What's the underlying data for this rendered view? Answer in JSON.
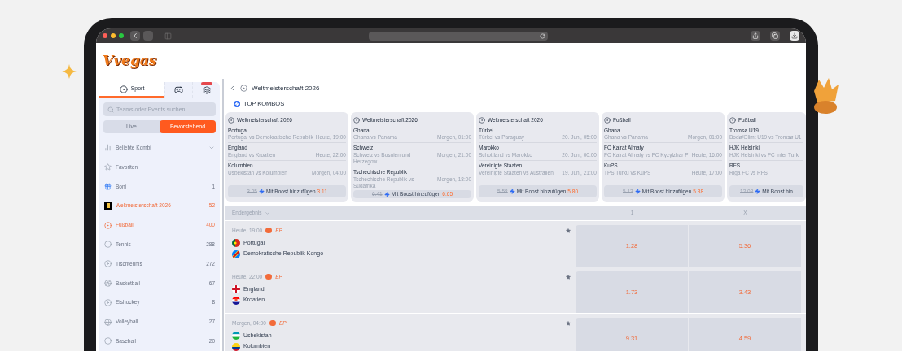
{
  "logo": {
    "text": "Vvegas"
  },
  "sidebar": {
    "tabs": [
      {
        "kind": "sport",
        "label": "Sport",
        "selected": true
      },
      {
        "kind": "games",
        "selected": false
      },
      {
        "kind": "casino",
        "selected": false
      }
    ],
    "search": {
      "placeholder": "Teams oder Events suchen"
    },
    "modes": [
      {
        "label": "Live",
        "selected": false
      },
      {
        "label": "Bevorstehend",
        "selected": true
      }
    ],
    "items": [
      {
        "kind": "combo",
        "label": "Beliebte Kombi",
        "expandable": true,
        "selected": false
      },
      {
        "kind": "favorites",
        "label": "Favoriten",
        "selected": false
      },
      {
        "kind": "bonus",
        "label": "Boni",
        "count": "1",
        "selected": false
      },
      {
        "kind": "worldcup",
        "label": "Weltmeisterschaft 2026",
        "count": "52",
        "selected": true
      },
      {
        "kind": "football",
        "label": "Fußball",
        "count": "400",
        "selected": true
      },
      {
        "kind": "tennis",
        "label": "Tennis",
        "count": "288",
        "selected": false
      },
      {
        "kind": "table_tennis",
        "label": "Tischtennis",
        "count": "272",
        "selected": false
      },
      {
        "kind": "basketball",
        "label": "Basketball",
        "count": "67",
        "selected": false
      },
      {
        "kind": "hockey",
        "label": "Eishockey",
        "count": "8",
        "selected": false
      },
      {
        "kind": "volleyball",
        "label": "Volleyball",
        "count": "27",
        "selected": false
      },
      {
        "kind": "baseball",
        "label": "Baseball",
        "count": "20",
        "selected": false
      }
    ]
  },
  "main": {
    "title": "Weltmeisterschaft 2026",
    "top_kombos": {
      "title": "TOP KOMBOS",
      "cards": [
        {
          "league": "Weltmeisterschaft 2026",
          "legs": [
            {
              "pick": "Portugal",
              "match": "Portugal vs Demokratische Republik",
              "time": "Heute, 19:00"
            },
            {
              "pick": "England",
              "match": "England vs Kroatien",
              "time": "Heute, 22:00"
            },
            {
              "pick": "Kolumbien",
              "match": "Usbekistan vs Kolumbien",
              "time": "Morgen, 04:00"
            }
          ],
          "old_odds": "3.05",
          "button": "Mit Boost hinzufügen",
          "new_odds": "3.11"
        },
        {
          "league": "Weltmeisterschaft 2026",
          "legs": [
            {
              "pick": "Ghana",
              "match": "Ghana vs Panama",
              "time": "Morgen, 01:00"
            },
            {
              "pick": "Schweiz",
              "match": "Schweiz vs Bosnien und Herzegow",
              "time": "Morgen, 21:00"
            },
            {
              "pick": "Tschechische Republik",
              "match": "Tschechische Republik vs Südafrika",
              "time": "Morgen, 18:00"
            }
          ],
          "old_odds": "6.41",
          "button": "Mit Boost hinzufügen",
          "new_odds": "6.65"
        },
        {
          "league": "Weltmeisterschaft 2026",
          "legs": [
            {
              "pick": "Türkei",
              "match": "Türkei vs Paraguay",
              "time": "20. Juni, 05:00"
            },
            {
              "pick": "Marokko",
              "match": "Schottland vs Marokko",
              "time": "20. Juni, 00:00"
            },
            {
              "pick": "Vereinigte Staaten",
              "match": "Vereinigte Staaten vs Australien",
              "time": "19. Juni, 21:00"
            }
          ],
          "old_odds": "5.58",
          "button": "Mit Boost hinzufügen",
          "new_odds": "5.80"
        },
        {
          "league": "Fußball",
          "legs": [
            {
              "pick": "Ghana",
              "match": "Ghana vs Panama",
              "time": "Morgen, 01:00"
            },
            {
              "pick": "FC Kairat Almaty",
              "match": "FC Kairat Almaty vs FC Kyzylzhar P",
              "time": "Heute, 16:00"
            },
            {
              "pick": "KuPS",
              "match": "TPS Turku vs KuPS",
              "time": "Heute, 17:00"
            }
          ],
          "old_odds": "5.13",
          "button": "Mit Boost hinzufügen",
          "new_odds": "5.38"
        },
        {
          "league": "Fußball",
          "legs": [
            {
              "pick": "Tromsø U19",
              "match": "Bodø/Glimt U19 vs Tromsø U1"
            },
            {
              "pick": "HJK Helsinki",
              "match": "HJK Helsinki vs FC Inter Turk"
            },
            {
              "pick": "RFS",
              "match": "Riga FC vs RFS"
            }
          ],
          "old_odds": "12.03",
          "button": "Mit Boost hin"
        }
      ]
    },
    "market": "Endergebnis",
    "columns": [
      "1",
      "X"
    ],
    "matches": [
      {
        "time": "Heute, 19:00",
        "tag": "EP",
        "teams": [
          {
            "name": "Portugal",
            "kind": "pt"
          },
          {
            "name": "Demokratische Republik Kongo",
            "kind": "cd"
          }
        ],
        "odds": [
          "1.28",
          "5.36"
        ]
      },
      {
        "time": "Heute, 22:00",
        "tag": "EP",
        "teams": [
          {
            "name": "England",
            "kind": "en"
          },
          {
            "name": "Kroatien",
            "kind": "hr"
          }
        ],
        "odds": [
          "1.73",
          "3.43"
        ]
      },
      {
        "time": "Morgen, 04:00",
        "tag": "EP",
        "teams": [
          {
            "name": "Usbekistan",
            "kind": "uz"
          },
          {
            "name": "Kolumbien",
            "kind": "co"
          }
        ],
        "odds": [
          "9.31",
          "4.59"
        ]
      }
    ]
  }
}
